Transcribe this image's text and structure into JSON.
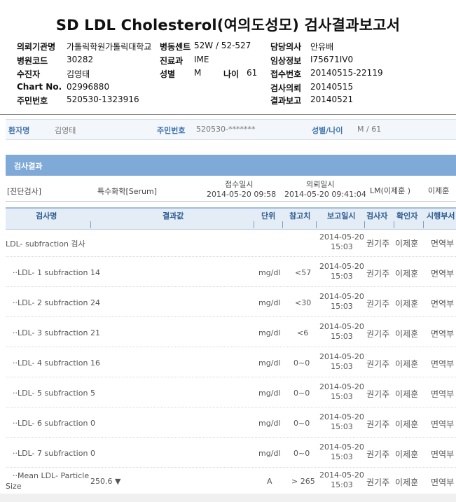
{
  "report": {
    "title": "SD LDL Cholesterol(여의도성모) 검사결과보고서",
    "fields": [
      {
        "label": "의뢰기관명",
        "value": "가톨릭학원가톨릭대학교"
      },
      {
        "label": "병동센트",
        "value": "52W / 52-527"
      },
      {
        "label": "담당의사",
        "value": "안유배"
      },
      {
        "label": "병원코드",
        "value": "30282"
      },
      {
        "label": "진료과",
        "value": "IME"
      },
      {
        "label": "임상정보",
        "value": "I75671IV0"
      },
      {
        "label": "수진자",
        "value": "김영태"
      },
      {
        "label": "성별",
        "value": "M"
      },
      {
        "label": "나이",
        "value": "61"
      },
      {
        "label": "접수번호",
        "value": "20140515-22119"
      },
      {
        "label": "Chart No.",
        "value": "02996880"
      },
      {
        "label": "검사의뢰",
        "value": "20140515"
      },
      {
        "label": "주민번호",
        "value": "520530-1323916"
      },
      {
        "label": "결과보고",
        "value": "20140521"
      }
    ]
  },
  "patient_bar": {
    "name_label": "환자명",
    "name_value": "김영태",
    "id_label": "주민번호",
    "id_value": "520530-*******",
    "sexage_label": "성별/나이",
    "sexage_value": "M / 61"
  },
  "results_title": "검사결과",
  "meta": {
    "dept": "[진단검사]",
    "specimen": "특수화학[Serum]",
    "received_label": "접수일시",
    "received": "2014-05-20 09:58",
    "ordered_label": "의뢰일시",
    "ordered": "2014-05-20 09:41:04",
    "lm": "LM(이제훈 )",
    "reporter": "이제훈"
  },
  "columns": [
    "검사명",
    "결과값",
    "단위",
    "참고치",
    "보고일시",
    "검사자",
    "확인자",
    "시행부서"
  ],
  "rows": [
    {
      "name": "LDL- subfraction 검사",
      "result": "",
      "unit": "",
      "ref": "",
      "date": "2014-05-20",
      "time": "15:03",
      "tester": "권기주",
      "confirmer": "이제훈",
      "dept": "면역부"
    },
    {
      "name": "··LDL- 1 subfraction",
      "result": "14",
      "unit": "mg/dl",
      "ref": "<57",
      "date": "2014-05-20",
      "time": "15:03",
      "tester": "권기주",
      "confirmer": "이제훈",
      "dept": "면역부"
    },
    {
      "name": "··LDL- 2 subfraction",
      "result": "24",
      "unit": "mg/dl",
      "ref": "<30",
      "date": "2014-05-20",
      "time": "15:03",
      "tester": "권기주",
      "confirmer": "이제훈",
      "dept": "면역부"
    },
    {
      "name": "··LDL- 3 subfraction",
      "result": "21",
      "unit": "mg/dl",
      "ref": "<6",
      "date": "2014-05-20",
      "time": "15:03",
      "tester": "권기주",
      "confirmer": "이제훈",
      "dept": "면역부"
    },
    {
      "name": "··LDL- 4 subfraction",
      "result": "16",
      "unit": "mg/dl",
      "ref": "0~0",
      "date": "2014-05-20",
      "time": "15:03",
      "tester": "권기주",
      "confirmer": "이제훈",
      "dept": "면역부"
    },
    {
      "name": "··LDL- 5 subfraction",
      "result": "5",
      "unit": "mg/dl",
      "ref": "0~0",
      "date": "2014-05-20",
      "time": "15:03",
      "tester": "권기주",
      "confirmer": "이제훈",
      "dept": "면역부"
    },
    {
      "name": "··LDL- 6 subfraction",
      "result": "0",
      "unit": "mg/dl",
      "ref": "0~0",
      "date": "2014-05-20",
      "time": "15:03",
      "tester": "권기주",
      "confirmer": "이제훈",
      "dept": "면역부"
    },
    {
      "name": "··LDL- 7 subfraction",
      "result": "0",
      "unit": "mg/dl",
      "ref": "0~0",
      "date": "2014-05-20",
      "time": "15:03",
      "tester": "권기주",
      "confirmer": "이제훈",
      "dept": "면역부"
    },
    {
      "name": "··Mean LDL- Particle",
      "name2": "Size",
      "result": "250.6 ▼",
      "unit": "A",
      "ref": "> 265",
      "date": "2014-05-20",
      "time": "15:03",
      "tester": "권기주",
      "confirmer": "이제훈",
      "dept": "면역부"
    }
  ]
}
